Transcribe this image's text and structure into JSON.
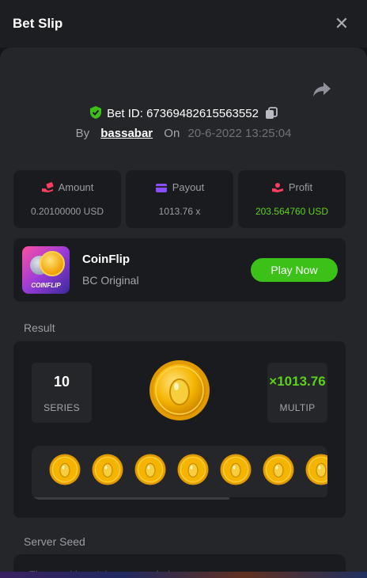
{
  "header": {
    "title": "Bet Slip",
    "close_icon": "close-icon"
  },
  "bet": {
    "id_label": "Bet ID: 67369482615563552",
    "by_label": "By",
    "user": "bassabar",
    "on_label": "On",
    "date": "20-6-2022 13:25:04"
  },
  "stats": {
    "amount": {
      "label": "Amount",
      "value": "0.20100000 USD",
      "icon": "money-hand-icon",
      "icon_color": "#ff3d5e"
    },
    "payout": {
      "label": "Payout",
      "value": "1013.76 x",
      "icon": "wallet-icon",
      "icon_color": "#8a4dff"
    },
    "profit": {
      "label": "Profit",
      "value": "203.564760 USD",
      "icon": "hand-coin-icon",
      "icon_color": "#ff3d5e"
    }
  },
  "game": {
    "thumb_label": "COINFLIP",
    "name": "CoinFlip",
    "subtitle": "BC Original",
    "play_label": "Play Now"
  },
  "result": {
    "section_label": "Result",
    "series_value": "10",
    "series_label": "SERIES",
    "multiplier_value": "×1013.76",
    "multiplier_label": "MULTIP",
    "coin_count_visible": 7
  },
  "seed": {
    "section_label": "Server Seed",
    "placeholder": "The seed hasn't been revealed yet"
  },
  "colors": {
    "accent_green": "#3bc117",
    "profit_green": "#5bd21a",
    "panel": "#24262a",
    "card": "#1a1b1e"
  }
}
